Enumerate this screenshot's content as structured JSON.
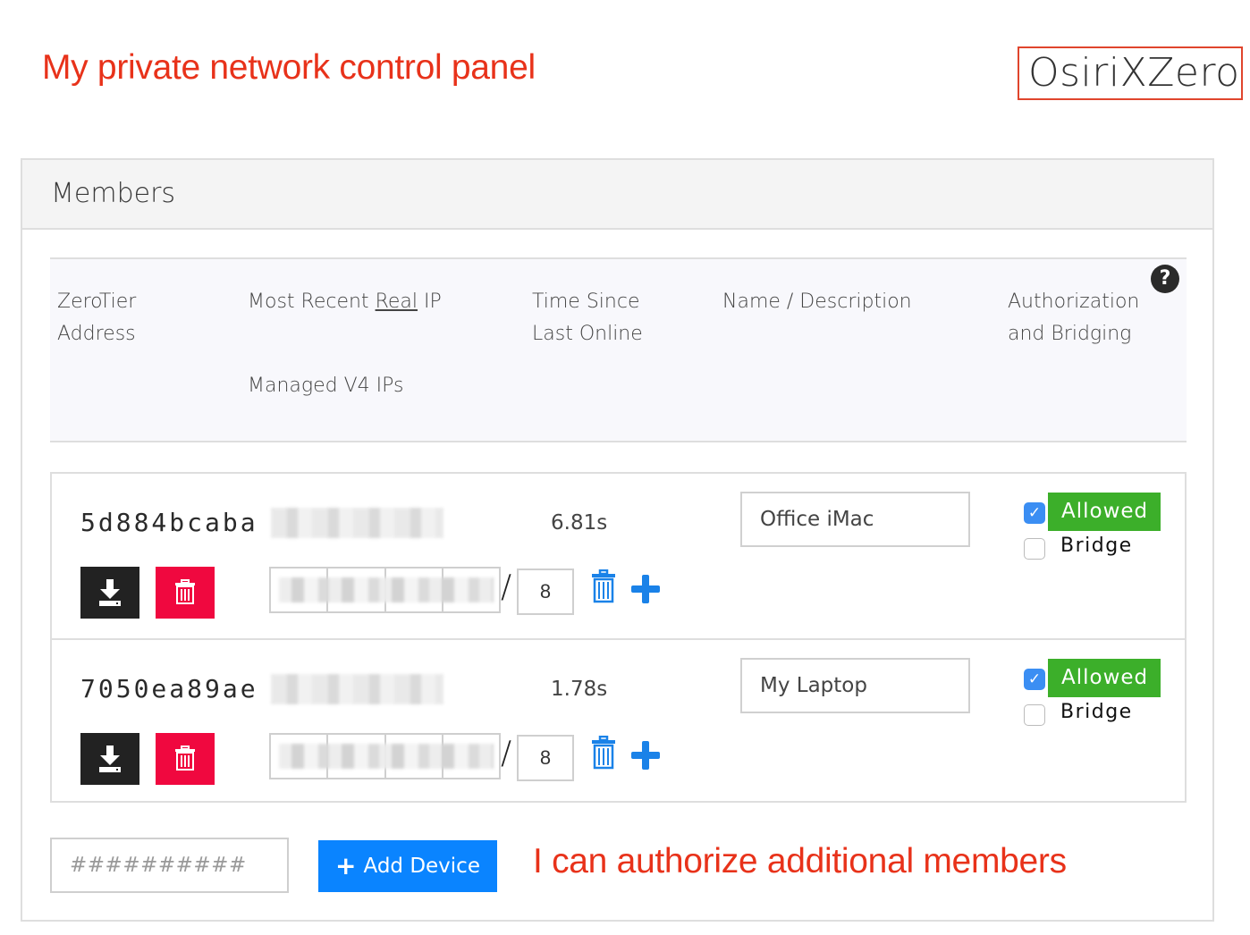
{
  "annotations": {
    "title": "My private network control panel",
    "add_members": "I can authorize additional members"
  },
  "brand": "OsiriXZero",
  "panel": {
    "title": "Members",
    "columns": {
      "address_line1": "ZeroTier",
      "address_line2": "Address",
      "real_ip_prefix": "Most Recent ",
      "real_ip_underlined": "Real",
      "real_ip_suffix": " IP",
      "managed_ips": "Managed V4 IPs",
      "time_line1": "Time Since",
      "time_line2": "Last Online",
      "name": "Name / Description",
      "auth_line1": "Authorization",
      "auth_line2": "and Bridging",
      "help_icon": "?"
    },
    "members": [
      {
        "address": "5d884bcaba",
        "real_ip": "[redacted]",
        "last_online": "6.81s",
        "name": "Office iMac",
        "authorized": true,
        "authorized_label": "Allowed",
        "bridge": false,
        "bridge_label": "Bridge",
        "managed_ip": "[redacted]",
        "prefix": "8"
      },
      {
        "address": "7050ea89ae",
        "real_ip": "[redacted]",
        "last_online": "1.78s",
        "name": "My Laptop",
        "authorized": true,
        "authorized_label": "Allowed",
        "bridge": false,
        "bridge_label": "Bridge",
        "managed_ip": "[redacted]",
        "prefix": "8"
      }
    ],
    "add": {
      "placeholder": "##########",
      "button_label": "Add Device",
      "button_icon": "+"
    }
  },
  "colors": {
    "annotation": "#e8321a",
    "allowed": "#3caf2a",
    "delete": "#f0083f",
    "primary": "#0a84ff"
  }
}
